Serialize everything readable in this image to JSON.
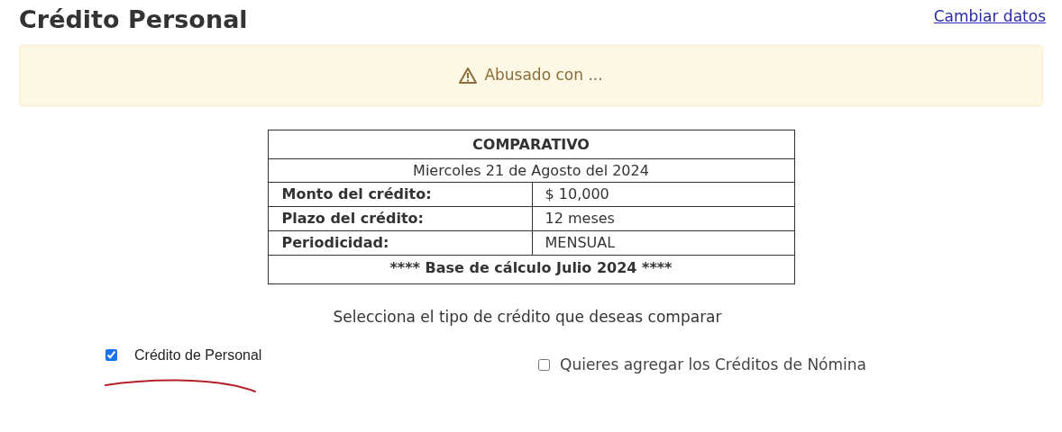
{
  "header": {
    "title": "Crédito Personal",
    "link": "Cambiar datos"
  },
  "alert": {
    "text": "Abusado con ..."
  },
  "table": {
    "title": "COMPARATIVO",
    "date": "Miercoles 21 de Agosto del 2024",
    "rows": [
      {
        "label": "Monto del crédito:",
        "value": "$ 10,000"
      },
      {
        "label": "Plazo del crédito:",
        "value": "12 meses"
      },
      {
        "label": "Periodicidad:",
        "value": "MENSUAL"
      }
    ],
    "footer": "**** Base de cálculo Julio 2024 ****"
  },
  "prompt": "Selecciona el tipo de crédito que deseas comparar",
  "options": [
    {
      "label": "Crédito de Personal",
      "checked": true,
      "underlined": true
    },
    {
      "label": "Quieres agregar los Créditos de Nómina",
      "checked": false,
      "underlined": false
    }
  ]
}
